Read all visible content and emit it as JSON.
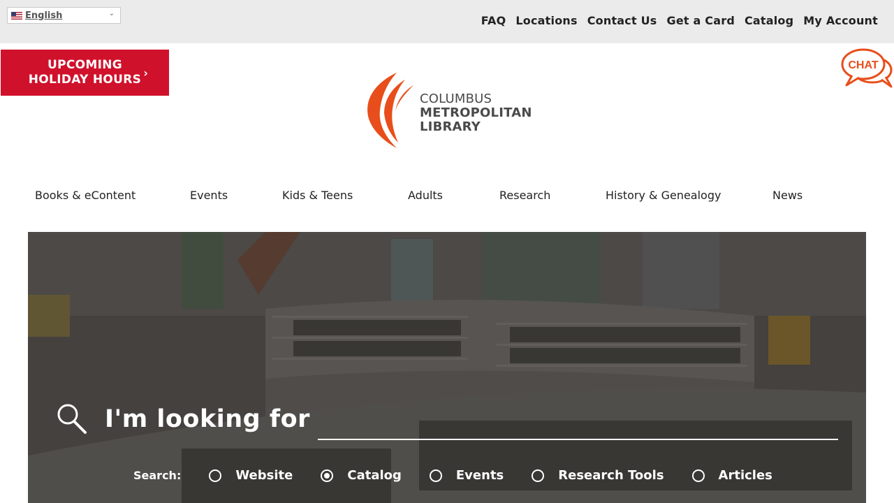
{
  "language": {
    "selected": "English"
  },
  "utility_nav": [
    "FAQ",
    "Locations",
    "Contact Us",
    "Get a Card",
    "Catalog",
    "My Account"
  ],
  "holiday_banner": {
    "line1": "UPCOMING",
    "line2": "HOLIDAY HOURS",
    "chevron": "›"
  },
  "chat": {
    "label": "CHAT"
  },
  "logo": {
    "line1": "COLUMBUS",
    "line2": "METROPOLITAN",
    "line3": "LIBRARY"
  },
  "main_nav": [
    "Books & eContent",
    "Events",
    "Kids & Teens",
    "Adults",
    "Research",
    "History & Genealogy",
    "News"
  ],
  "search": {
    "title": "I'm looking for",
    "input_value": "",
    "label": "Search:",
    "options": [
      {
        "label": "Website",
        "selected": false
      },
      {
        "label": "Catalog",
        "selected": true
      },
      {
        "label": "Events",
        "selected": false
      },
      {
        "label": "Research Tools",
        "selected": false
      },
      {
        "label": "Articles",
        "selected": false
      }
    ]
  },
  "colors": {
    "brand_red": "#d0112b",
    "logo_orange": "#e84e1b",
    "topbar_bg": "#ebebeb"
  },
  "icons": {
    "search": "magnifier-icon",
    "chat": "chat-bubble-icon",
    "flag": "us-flag-icon"
  }
}
